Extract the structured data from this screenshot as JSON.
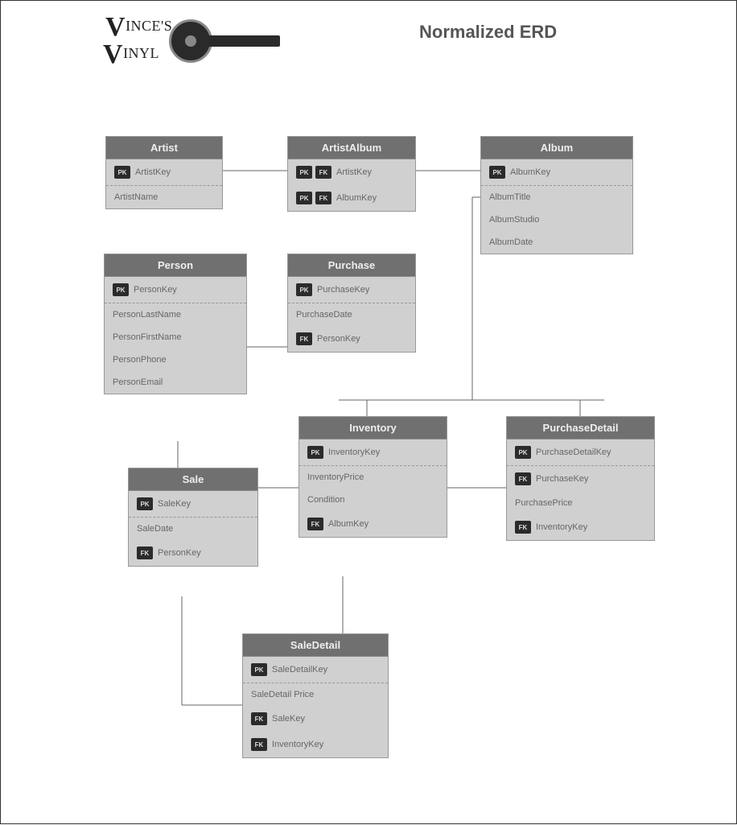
{
  "title": "Normalized ERD",
  "logo": {
    "line1": "INCE'S",
    "line2": "INYL"
  },
  "keys": {
    "pk": "PK",
    "fk": "FK"
  },
  "entities": {
    "artist": {
      "name": "Artist",
      "attrs": [
        {
          "keys": [
            "pk"
          ],
          "label": "ArtistKey",
          "sep": true
        },
        {
          "keys": [],
          "label": "ArtistName"
        }
      ]
    },
    "artistAlbum": {
      "name": "ArtistAlbum",
      "attrs": [
        {
          "keys": [
            "pk",
            "fk"
          ],
          "label": "ArtistKey"
        },
        {
          "keys": [
            "pk",
            "fk"
          ],
          "label": "AlbumKey"
        }
      ]
    },
    "album": {
      "name": "Album",
      "attrs": [
        {
          "keys": [
            "pk"
          ],
          "label": "AlbumKey",
          "sep": true
        },
        {
          "keys": [],
          "label": "AlbumTitle"
        },
        {
          "keys": [],
          "label": "AlbumStudio"
        },
        {
          "keys": [],
          "label": "AlbumDate"
        }
      ]
    },
    "person": {
      "name": "Person",
      "attrs": [
        {
          "keys": [
            "pk"
          ],
          "label": "PersonKey",
          "sep": true
        },
        {
          "keys": [],
          "label": "PersonLastName"
        },
        {
          "keys": [],
          "label": "PersonFirstName"
        },
        {
          "keys": [],
          "label": "PersonPhone"
        },
        {
          "keys": [],
          "label": "PersonEmail"
        }
      ]
    },
    "purchase": {
      "name": "Purchase",
      "attrs": [
        {
          "keys": [
            "pk"
          ],
          "label": "PurchaseKey",
          "sep": true
        },
        {
          "keys": [],
          "label": "PurchaseDate"
        },
        {
          "keys": [
            "fk"
          ],
          "label": "PersonKey"
        }
      ]
    },
    "inventory": {
      "name": "Inventory",
      "attrs": [
        {
          "keys": [
            "pk"
          ],
          "label": "InventoryKey",
          "sep": true
        },
        {
          "keys": [],
          "label": "InventoryPrice"
        },
        {
          "keys": [],
          "label": "Condition"
        },
        {
          "keys": [
            "fk"
          ],
          "label": "AlbumKey"
        }
      ]
    },
    "purchaseDetail": {
      "name": "PurchaseDetail",
      "attrs": [
        {
          "keys": [
            "pk"
          ],
          "label": "PurchaseDetailKey",
          "sep": true
        },
        {
          "keys": [
            "fk"
          ],
          "label": "PurchaseKey"
        },
        {
          "keys": [],
          "label": "PurchasePrice"
        },
        {
          "keys": [
            "fk"
          ],
          "label": "InventoryKey"
        }
      ]
    },
    "sale": {
      "name": "Sale",
      "attrs": [
        {
          "keys": [
            "pk"
          ],
          "label": "SaleKey",
          "sep": true
        },
        {
          "keys": [],
          "label": "SaleDate"
        },
        {
          "keys": [
            "fk"
          ],
          "label": "PersonKey"
        }
      ]
    },
    "saleDetail": {
      "name": "SaleDetail",
      "attrs": [
        {
          "keys": [
            "pk"
          ],
          "label": "SaleDetailKey",
          "sep": true
        },
        {
          "keys": [],
          "label": "SaleDetail Price"
        },
        {
          "keys": [
            "fk"
          ],
          "label": "SaleKey"
        },
        {
          "keys": [
            "fk"
          ],
          "label": "InventoryKey"
        }
      ]
    }
  }
}
